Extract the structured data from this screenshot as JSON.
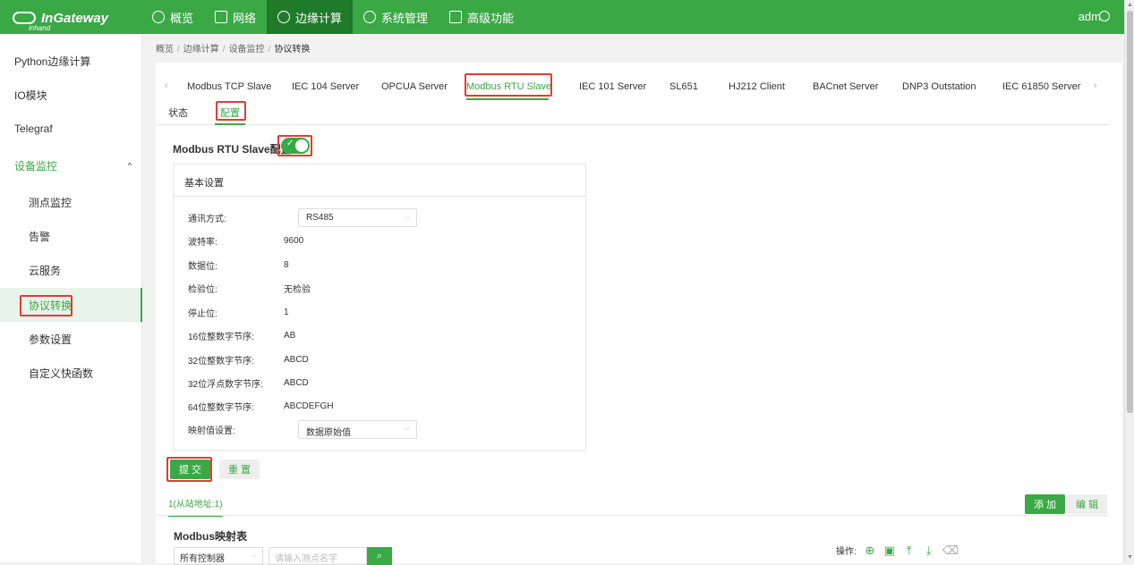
{
  "header": {
    "logo_text": "InGateway",
    "logo_sub": "inhand",
    "nav": [
      {
        "label": "概览",
        "icon": "dashboard-icon"
      },
      {
        "label": "网络",
        "icon": "network-icon"
      },
      {
        "label": "边缘计算",
        "icon": "edge-computing-icon"
      },
      {
        "label": "系统管理",
        "icon": "gear-icon"
      },
      {
        "label": "高级功能",
        "icon": "grid-icon"
      }
    ],
    "active_nav": "边缘计算",
    "user": "adm"
  },
  "sidebar": {
    "items": [
      {
        "label": "Python边缘计算"
      },
      {
        "label": "IO模块"
      },
      {
        "label": "Telegraf"
      },
      {
        "label": "设备监控"
      },
      {
        "label": "测点监控"
      },
      {
        "label": "告警"
      },
      {
        "label": "云服务"
      },
      {
        "label": "协议转换"
      },
      {
        "label": "参数设置"
      },
      {
        "label": "自定义快函数"
      }
    ]
  },
  "breadcrumb": [
    "概览",
    "边缘计算",
    "设备监控",
    "协议转换"
  ],
  "tabs": [
    "Modbus TCP Slave",
    "IEC 104 Server",
    "OPCUA Server",
    "Modbus RTU Slave",
    "IEC 101 Server",
    "SL651",
    "HJ212 Client",
    "BACnet Server",
    "DNP3 Outstation",
    "IEC 61850 Server"
  ],
  "active_tab": "Modbus RTU Slave",
  "subtabs": [
    "状态",
    "配置"
  ],
  "active_subtab": "配置",
  "config": {
    "title": "Modbus RTU Slave配置",
    "enabled": true,
    "panel_title": "基本设置",
    "fields": [
      {
        "label": "通讯方式:",
        "value": "RS485",
        "type": "select"
      },
      {
        "label": "波特率:",
        "value": "9600",
        "type": "text"
      },
      {
        "label": "数据位:",
        "value": "8",
        "type": "text"
      },
      {
        "label": "检验位:",
        "value": "无检验",
        "type": "text"
      },
      {
        "label": "停止位:",
        "value": "1",
        "type": "text"
      },
      {
        "label": "16位整数字节序:",
        "value": "AB",
        "type": "text"
      },
      {
        "label": "32位整数字节序:",
        "value": "ABCD",
        "type": "text"
      },
      {
        "label": "32位浮点数字节序:",
        "value": "ABCD",
        "type": "text"
      },
      {
        "label": "64位整数字节序:",
        "value": "ABCDEFGH",
        "type": "text"
      },
      {
        "label": "映射值设置:",
        "value": "数据原始值",
        "type": "select"
      }
    ],
    "submit_label": "提 交",
    "reset_label": "重 置"
  },
  "slave": {
    "tab_label": "1(从站地址:1)",
    "add_label": "添 加",
    "edit_label": "编 辑"
  },
  "mapping": {
    "title": "Modbus映射表",
    "controller_select": "所有控制器",
    "search_placeholder": "请输入测点名字",
    "ops_label": "操作:"
  },
  "colors": {
    "brand": "#3ba846",
    "brand_dark": "#1f7a2a",
    "highlight": "#e23c34"
  }
}
